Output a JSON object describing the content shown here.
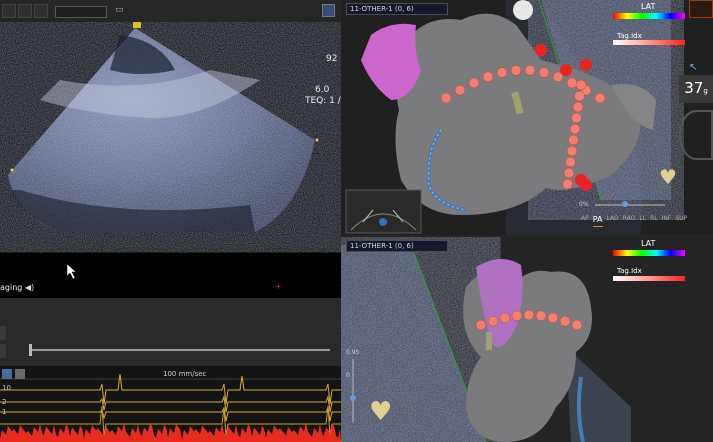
{
  "echo": {
    "depth_value": "92",
    "params": [
      "6.0",
      "TEQ: 1 /"
    ],
    "mode_label": "aging",
    "marker": "+"
  },
  "timeline": {},
  "ecg": {
    "sweep": "100 mm/sec",
    "labels": [
      "10",
      "2",
      "1"
    ]
  },
  "carto": {
    "top_view": {
      "selector": "11-OTHER-1 (0, 6)",
      "legend_title": "LAT",
      "tag_label": "Tag.Idx",
      "counter": "37",
      "counter_sub": "g",
      "zoom": "0%",
      "view_buttons": [
        "AP",
        "PA",
        "LAO",
        "RAO",
        "LL",
        "RL",
        "INF",
        "SUP"
      ],
      "active_view": "PA"
    },
    "bottom_view": {
      "selector": "11-OTHER-1 (0, 6)",
      "legend_title": "LAT",
      "tag_label": "Tag.Idx",
      "scale_top": "0.95",
      "scale_mid": "0"
    }
  },
  "colors": {
    "legend_gradient": [
      "#ff0000",
      "#ffff00",
      "#00ff00",
      "#00ffff",
      "#0000ff",
      "#ff00ff"
    ],
    "tag_red": "#ff2020",
    "ecg_yellow": "#d8b020",
    "ecg_red": "#ff3020"
  }
}
